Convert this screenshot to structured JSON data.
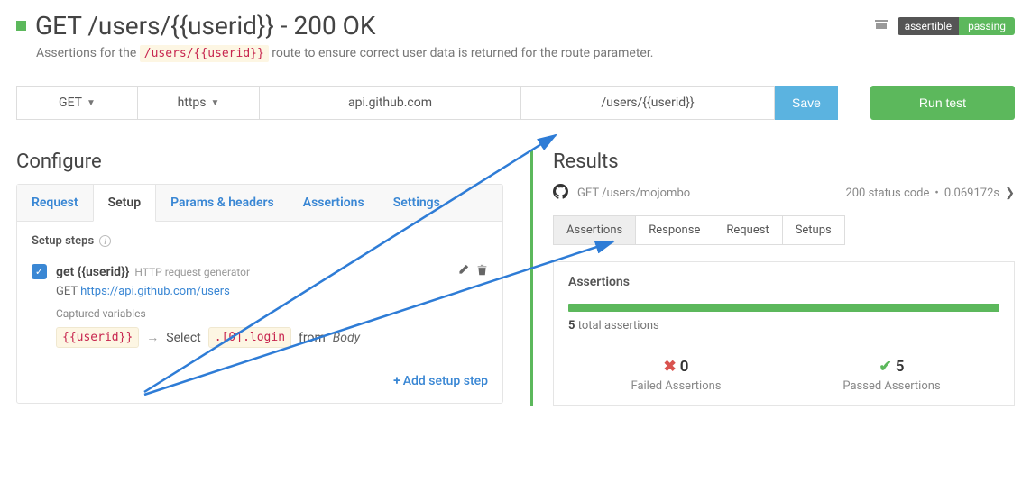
{
  "header": {
    "title": "GET /users/{{userid}} - 200 OK",
    "badge_left": "assertible",
    "badge_right": "passing",
    "subtitle_before": "Assertions for the ",
    "subtitle_code": "/users/{{userid}}",
    "subtitle_after": " route to ensure correct user data is returned for the route parameter."
  },
  "request_bar": {
    "method": "GET",
    "scheme": "https",
    "host": "api.github.com",
    "path": "/users/{{userid}}",
    "save": "Save",
    "run": "Run test"
  },
  "configure": {
    "heading": "Configure",
    "tabs": [
      "Request",
      "Setup",
      "Params & headers",
      "Assertions",
      "Settings"
    ],
    "active_tab": 1,
    "section_label": "Setup steps",
    "step": {
      "title": "get {{userid}}",
      "subtitle": "HTTP request generator",
      "method": "GET",
      "url": "https://api.github.com/users",
      "captured_label": "Captured variables",
      "var_chip": "{{userid}}",
      "select_word": "Select",
      "selector_chip": ".[0].login",
      "from_word": "from",
      "body_word": "Body"
    },
    "add_step": "Add setup step"
  },
  "results": {
    "heading": "Results",
    "request_line": "GET /users/mojombo",
    "status": "200 status code",
    "timing": "0.069172s",
    "tabs": [
      "Assertions",
      "Response",
      "Request",
      "Setups"
    ],
    "active_tab": 0,
    "panel_title": "Assertions",
    "total_count": "5",
    "total_label": " total assertions",
    "failed_count": "0",
    "failed_label": "Failed Assertions",
    "passed_count": "5",
    "passed_label": "Passed Assertions"
  }
}
